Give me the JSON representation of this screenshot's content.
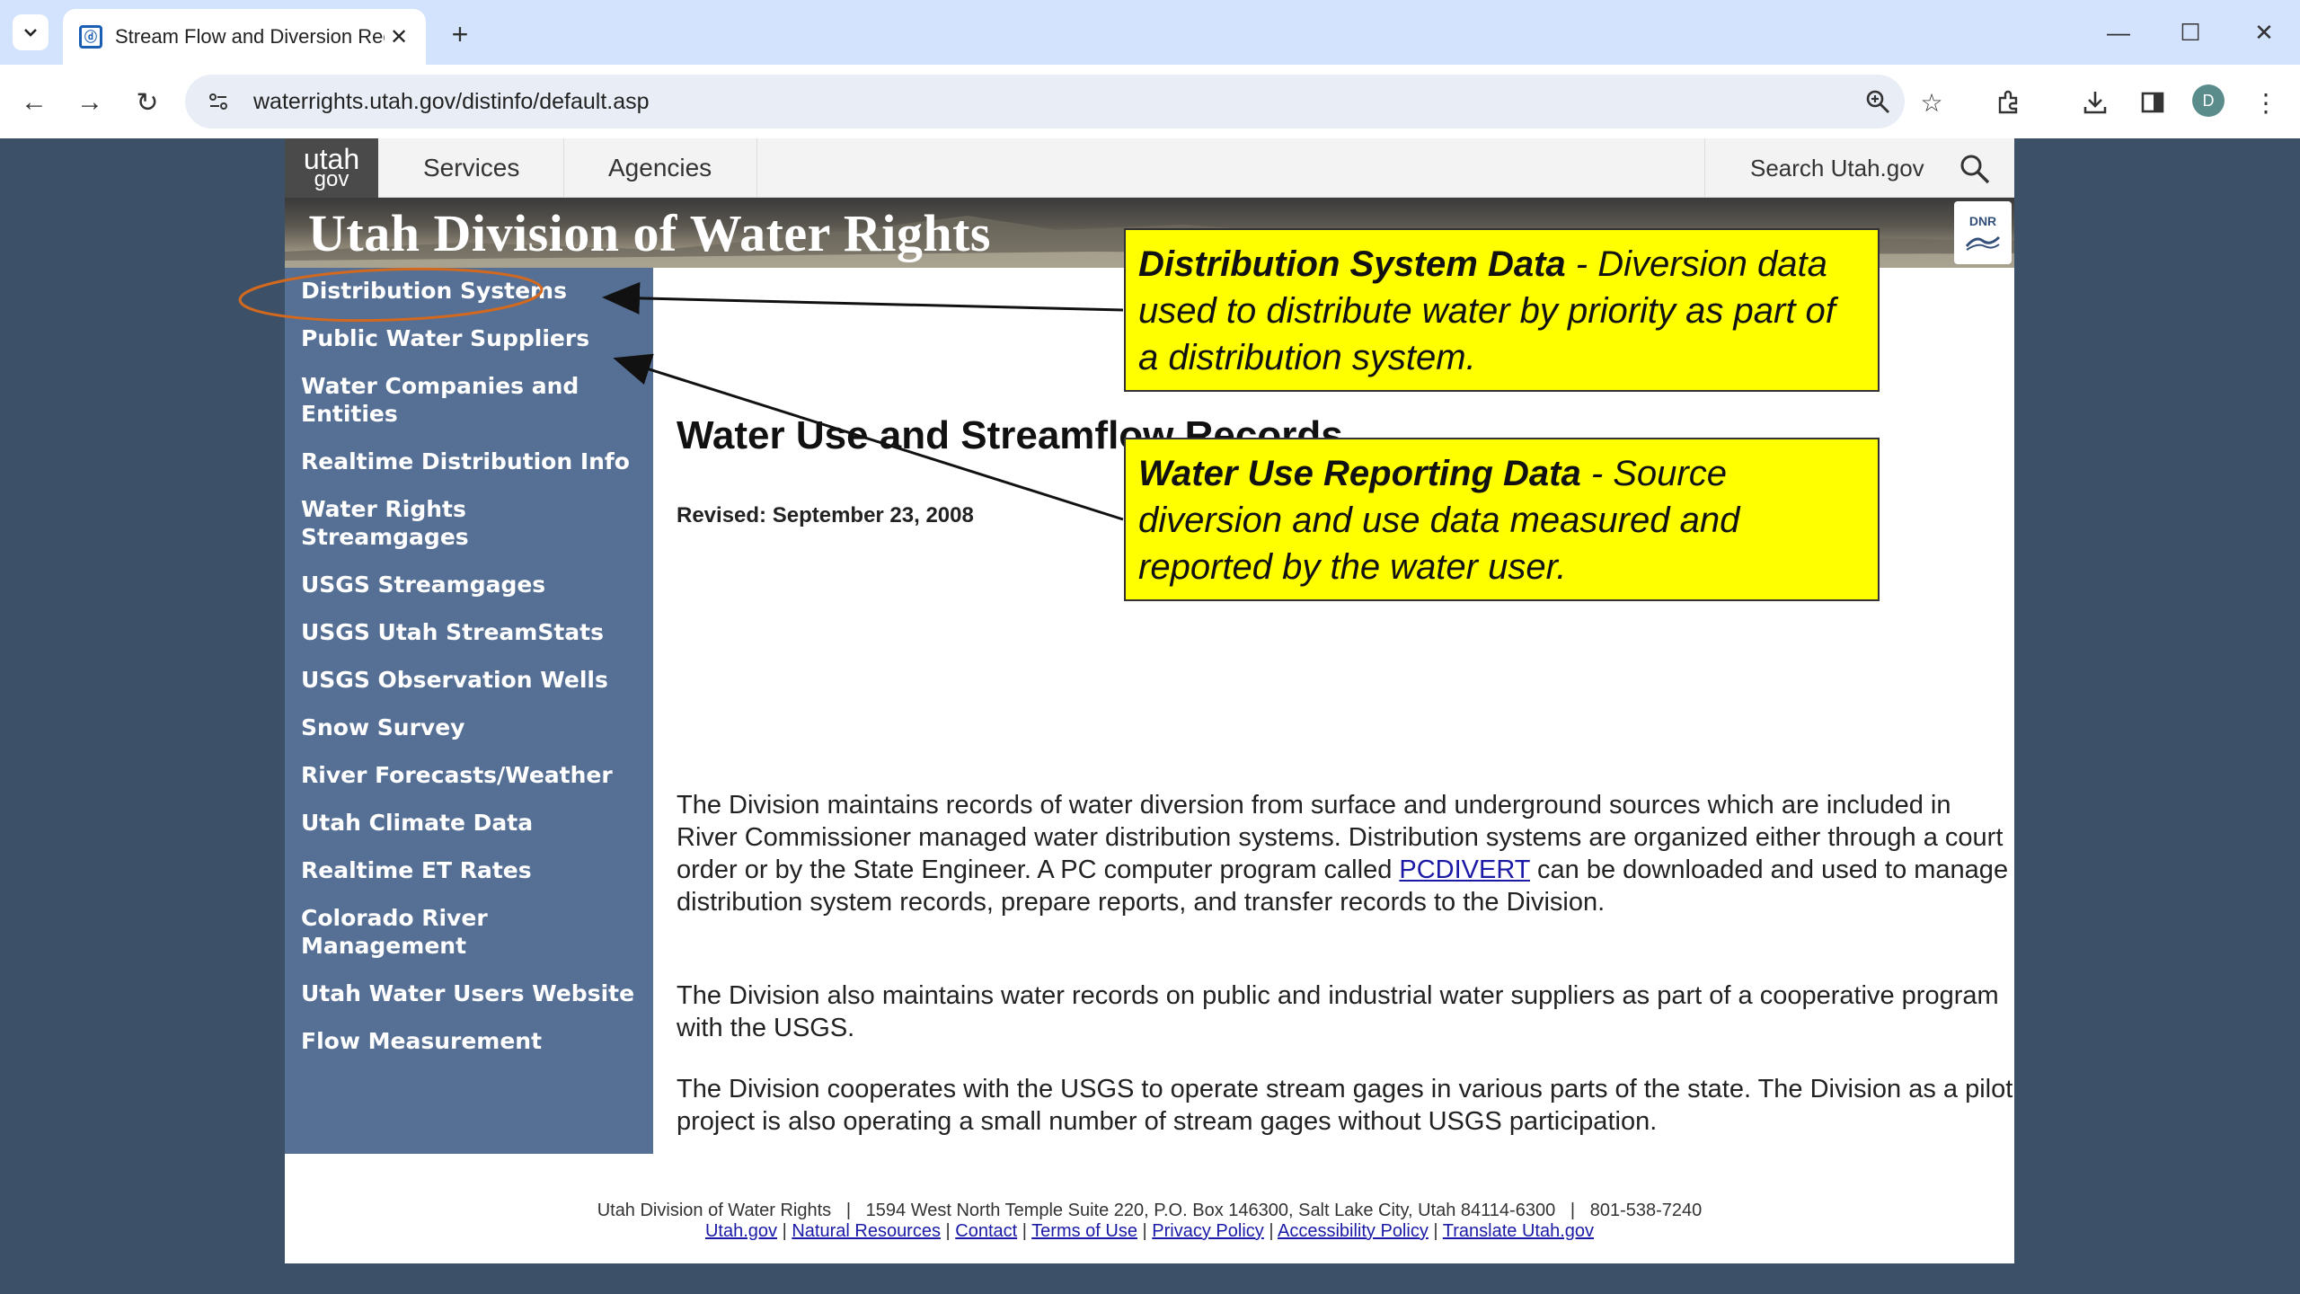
{
  "browser": {
    "tab_title": "Stream Flow and Diversion Rec",
    "url": "waterrights.utah.gov/distinfo/default.asp",
    "profile_initial": "D",
    "icons": {
      "tab_menu": "chevron-down-icon",
      "favicon": "page-favicon",
      "close": "close-icon",
      "new_tab": "plus-icon",
      "back": "back-arrow-icon",
      "forward": "forward-arrow-icon",
      "reload": "reload-icon",
      "site_info": "site-info-icon",
      "zoom": "zoom-icon",
      "bookmark": "star-icon",
      "extensions": "puzzle-icon",
      "downloads": "download-icon",
      "side_panel": "side-panel-icon",
      "menu": "kebab-menu-icon"
    }
  },
  "utah_nav": {
    "logo_top": "utah",
    "logo_bottom": "gov",
    "services": "Services",
    "agencies": "Agencies",
    "search_label": "Search Utah.gov"
  },
  "banner": {
    "title": "Utah Division of Water Rights",
    "dnr_logo": "DNR"
  },
  "sidebar": {
    "items": [
      {
        "label": "Distribution Systems"
      },
      {
        "label": "Public Water Suppliers"
      },
      {
        "label": "Water Companies and Entities"
      },
      {
        "label": "Realtime Distribution Info"
      },
      {
        "label": "Water Rights Streamgages"
      },
      {
        "label": "USGS Streamgages"
      },
      {
        "label": "USGS Utah StreamStats"
      },
      {
        "label": "USGS Observation Wells"
      },
      {
        "label": "Snow Survey"
      },
      {
        "label": "River Forecasts/Weather"
      },
      {
        "label": "Utah Climate Data"
      },
      {
        "label": "Realtime ET Rates"
      },
      {
        "label": "Colorado River Management"
      },
      {
        "label": "Utah Water Users Website"
      },
      {
        "label": "Flow Measurement"
      }
    ]
  },
  "main": {
    "title": "Water Use and Streamflow Records",
    "revised": "Revised: September 23, 2008",
    "para1_before": "The Division maintains records of water diversion from surface and underground sources which are included in River Commissioner managed water distribution systems. Distribution systems are organized either through a court order or by the State Engineer. A PC computer program called ",
    "para1_link": "PCDIVERT",
    "para1_after": " can be downloaded and used to manage distribution system records, prepare reports, and transfer records to the Division.",
    "para2": "The Division also maintains water records on public and industrial water suppliers as part of a cooperative program with the USGS.",
    "para3": "The Division cooperates with the USGS to operate stream gages in various parts of the state. The Division as a pilot project is also operating a small number of stream gages without USGS participation."
  },
  "footer": {
    "line1": "Utah Division of Water Rights   |   1594 West North Temple Suite 220, P.O. Box 146300, Salt Lake City, Utah 84114-6300   |   801-538-7240",
    "links": [
      "Utah.gov",
      "Natural Resources",
      "Contact",
      "Terms of Use",
      "Privacy Policy",
      "Accessibility Policy",
      "Translate Utah.gov"
    ],
    "separator": " | "
  },
  "annotations": {
    "callout1_bold": "Distribution System Data",
    "callout1_rest": " - Diversion data used to distribute water by priority as part of a distribution system.",
    "callout2_bold": "Water Use Reporting Data",
    "callout2_rest": " - Source diversion and use data measured and reported by the water user.",
    "callout_color": "#ffff00",
    "circle_color": "#d2691e"
  },
  "colors": {
    "tabstrip": "#d3e3fd",
    "sidebar": "#556f95",
    "page_bg": "#3c5068",
    "link": "#1a1aa6"
  }
}
